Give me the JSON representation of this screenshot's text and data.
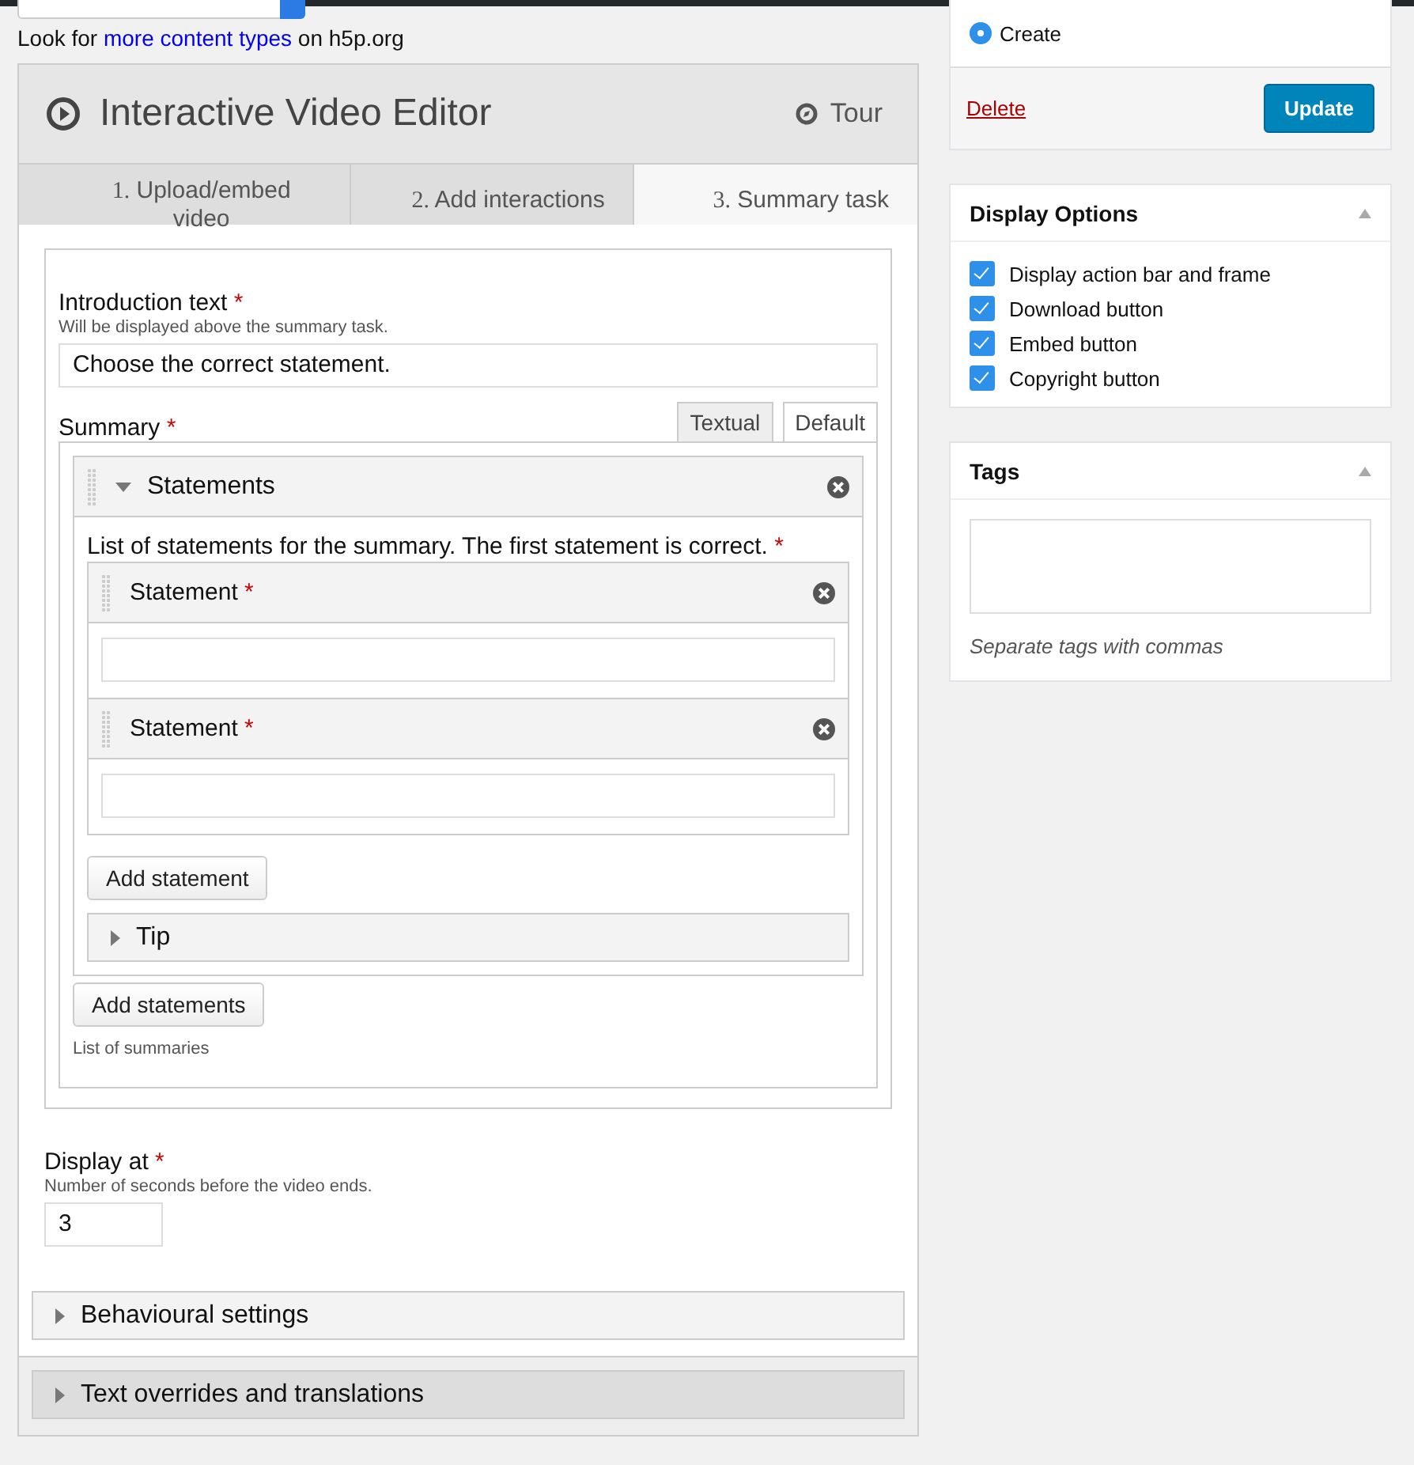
{
  "intro_line": {
    "prefix": "Look for",
    "link": "more content types",
    "suffix": "on h5p.org"
  },
  "editor": {
    "title": "Interactive Video Editor",
    "tour": "Tour",
    "tabs": [
      {
        "number": "1.",
        "label": "Upload/embed video",
        "selected": false
      },
      {
        "number": "2.",
        "label": "Add interactions",
        "selected": false
      },
      {
        "number": "3.",
        "label": "Summary task",
        "selected": true
      }
    ],
    "intro": {
      "label": "Introduction text",
      "required_mark": "*",
      "description": "Will be displayed above the summary task.",
      "value": "Choose the correct statement."
    },
    "summary": {
      "label": "Summary",
      "required_mark": "*",
      "mode_tabs": [
        {
          "label": "Textual",
          "selected": false
        },
        {
          "label": "Default",
          "selected": true
        }
      ],
      "group": {
        "title": "Statements",
        "expanded": true,
        "description": "List of statements for the summary. The first statement is correct.",
        "required_mark": "*",
        "statements": [
          {
            "label": "Statement",
            "required_mark": "*"
          },
          {
            "label": "Statement",
            "required_mark": "*"
          }
        ],
        "add_button": "Add statement",
        "tip": {
          "label": "Tip",
          "expanded": false
        }
      },
      "add_button": "Add statements",
      "description": "List of summaries"
    },
    "display_at": {
      "label": "Display at",
      "required_mark": "*",
      "description": "Number of seconds before the video ends.",
      "value": "3"
    },
    "sections": [
      {
        "label": "Behavioural settings",
        "expanded": false,
        "kind": "inner"
      },
      {
        "label": "Text overrides and translations",
        "expanded": false,
        "kind": "outer"
      }
    ]
  },
  "publish": {
    "status": {
      "label": "Create",
      "selected": true
    },
    "delete": "Delete",
    "update": "Update"
  },
  "display_options": {
    "title": "Display Options",
    "options": [
      {
        "label": "Display action bar and frame",
        "checked": true
      },
      {
        "label": "Download button",
        "checked": true
      },
      {
        "label": "Embed button",
        "checked": true
      },
      {
        "label": "Copyright button",
        "checked": true
      }
    ]
  },
  "tags": {
    "title": "Tags",
    "hint": "Separate tags with commas"
  }
}
